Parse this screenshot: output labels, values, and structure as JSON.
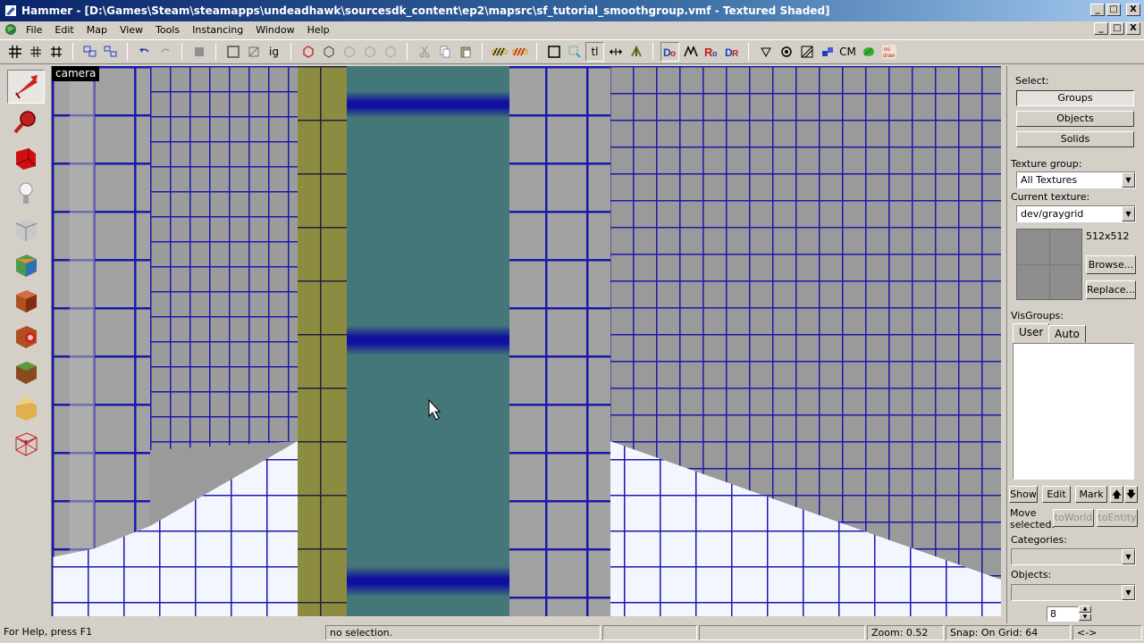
{
  "window": {
    "title": "Hammer - [D:\\Games\\Steam\\steamapps\\undeadhawk\\sourcesdk_content\\ep2\\mapsrc\\sf_tutorial_smoothgroup.vmf - Textured Shaded]",
    "minimize": "_",
    "maximize": "□",
    "close": "X"
  },
  "menu": {
    "items": [
      "File",
      "Edit",
      "Map",
      "View",
      "Tools",
      "Instancing",
      "Window",
      "Help"
    ]
  },
  "viewport": {
    "label": "camera",
    "wall_color": "#9a9a9a",
    "grid_color": "#1818b0",
    "floor_color": "#f4f6ff",
    "teal_color": "#447878",
    "yellow_color": "#8c8c40"
  },
  "panel": {
    "select_label": "Select:",
    "groups_btn": "Groups",
    "objects_btn": "Objects",
    "solids_btn": "Solids",
    "texture_group_label": "Texture group:",
    "texture_group_value": "All Textures",
    "current_texture_label": "Current texture:",
    "current_texture_value": "dev/graygrid",
    "texture_size": "512x512",
    "browse_btn": "Browse...",
    "replace_btn": "Replace...",
    "visgroups_label": "VisGroups:",
    "tab_user": "User",
    "tab_auto": "Auto",
    "show_btn": "Show",
    "edit_btn": "Edit",
    "mark_btn": "Mark",
    "up_btn": "🡅",
    "down_btn": "🡇",
    "move_selected_label": "Move selected:",
    "to_world_btn": "toWorld",
    "to_entity_btn": "toEntity",
    "categories_label": "Categories:",
    "objects_label": "Objects:",
    "spin_value": "8"
  },
  "status": {
    "help": "For Help, press F1",
    "selection": "no selection.",
    "zoom": "Zoom: 0.52",
    "snap": "Snap: On Grid: 64",
    "extra": "<->"
  }
}
